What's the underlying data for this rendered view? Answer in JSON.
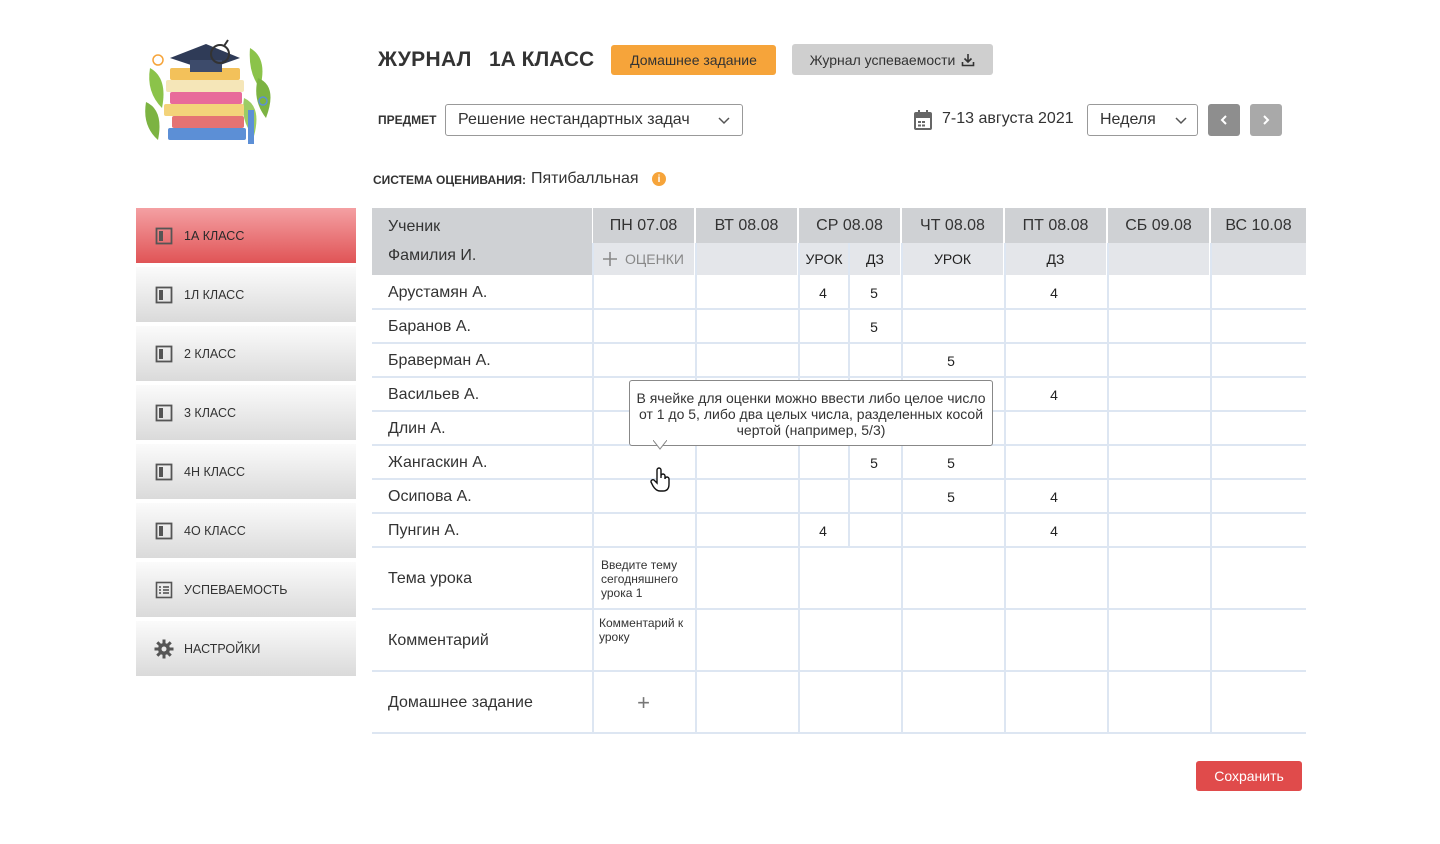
{
  "header": {
    "title": "ЖУРНАЛ",
    "class_name": "1А КЛАСС",
    "homework_button": "Домашнее задание",
    "journal_button": "Журнал успеваемости"
  },
  "filters": {
    "subject_label": "ПРЕДМЕТ",
    "subject_value": "Решение нестандартных задач",
    "date_range": "7-13 августа 2021",
    "period_value": "Неделя"
  },
  "grading": {
    "label": "СИСТЕМА ОЦЕНИВАНИЯ:",
    "value": "Пятибалльная",
    "info_icon": "i"
  },
  "sidebar": {
    "items": [
      {
        "label": "1А КЛАСС",
        "icon": "book-icon",
        "active": true
      },
      {
        "label": "1Л КЛАСС",
        "icon": "book-icon",
        "active": false
      },
      {
        "label": "2 КЛАСС",
        "icon": "book-icon",
        "active": false
      },
      {
        "label": "3 КЛАСС",
        "icon": "book-icon",
        "active": false
      },
      {
        "label": "4Н КЛАСС",
        "icon": "book-icon",
        "active": false
      },
      {
        "label": "4О КЛАСС",
        "icon": "book-icon",
        "active": false
      },
      {
        "label": "УСПЕВАЕМОСТЬ",
        "icon": "list-icon",
        "active": false
      },
      {
        "label": "НАСТРОЙКИ",
        "icon": "gear-icon",
        "active": false
      }
    ]
  },
  "table": {
    "student_header_line1": "Ученик",
    "student_header_line2": "Фамилия И.",
    "days": [
      "ПН 07.08",
      "ВТ 08.08",
      "СР 08.08",
      "ЧТ 08.08",
      "ПТ 08.08",
      "СБ 09.08",
      "ВС 10.08"
    ],
    "add_grades_label": "ОЦЕНКИ",
    "sub_wed_lesson": "УРОК",
    "sub_wed_hw": "ДЗ",
    "sub_thu_lesson": "УРОК",
    "sub_fri_hw": "ДЗ",
    "students": [
      {
        "name": "Арустамян А.",
        "wed_lesson": "4",
        "wed_hw": "5",
        "thu_lesson": "",
        "fri_hw": "4"
      },
      {
        "name": "Баранов А.",
        "wed_lesson": "",
        "wed_hw": "5",
        "thu_lesson": "",
        "fri_hw": ""
      },
      {
        "name": "Браверман А.",
        "wed_lesson": "",
        "wed_hw": "",
        "thu_lesson": "5",
        "fri_hw": ""
      },
      {
        "name": "Васильев А.",
        "wed_lesson": "",
        "wed_hw": "",
        "thu_lesson": "",
        "fri_hw": "4"
      },
      {
        "name": "Длин А.",
        "wed_lesson": "",
        "wed_hw": "",
        "thu_lesson": "",
        "fri_hw": ""
      },
      {
        "name": "Жангаскин А.",
        "wed_lesson": "",
        "wed_hw": "5",
        "thu_lesson": "5",
        "fri_hw": ""
      },
      {
        "name": "Осипова А.",
        "wed_lesson": "",
        "wed_hw": "",
        "thu_lesson": "5",
        "fri_hw": "4"
      },
      {
        "name": "Пунгин А.",
        "wed_lesson": "4",
        "wed_hw": "",
        "thu_lesson": "",
        "fri_hw": "4"
      }
    ],
    "topic_label": "Тема урока",
    "topic_placeholder": "Введите тему сегодняшнего урока 1",
    "comment_label": "Комментарий",
    "comment_placeholder": "Комментарий к уроку",
    "homework_label": "Домашнее задание",
    "homework_add": "+"
  },
  "tooltip": {
    "text": "В ячейке для оценки можно ввести либо целое число от 1 до 5, либо два целых числа, разделенных косой чертой (например, 5/3)"
  },
  "footer": {
    "save_button": "Сохранить"
  },
  "colors": {
    "accent_orange": "#f6a43a",
    "active_red": "#e05456",
    "save_red": "#e04b4b",
    "header_gray": "#cfd1d4"
  }
}
